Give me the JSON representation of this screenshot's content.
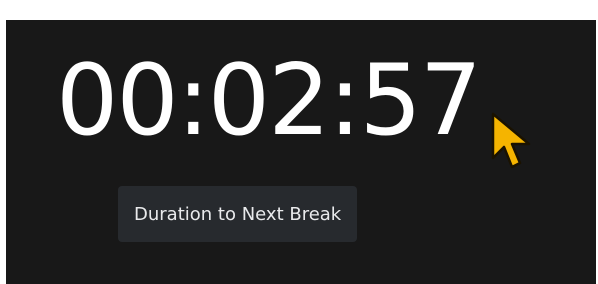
{
  "timer": {
    "display": "00:02:57"
  },
  "tooltip": {
    "label": "Duration to Next Break"
  },
  "cursor": {
    "icon": "pointer-arrow-icon",
    "color": "#f5b400"
  },
  "colors": {
    "panel_background": "#181818",
    "text": "#ffffff",
    "tooltip_background": "#272a2e"
  }
}
